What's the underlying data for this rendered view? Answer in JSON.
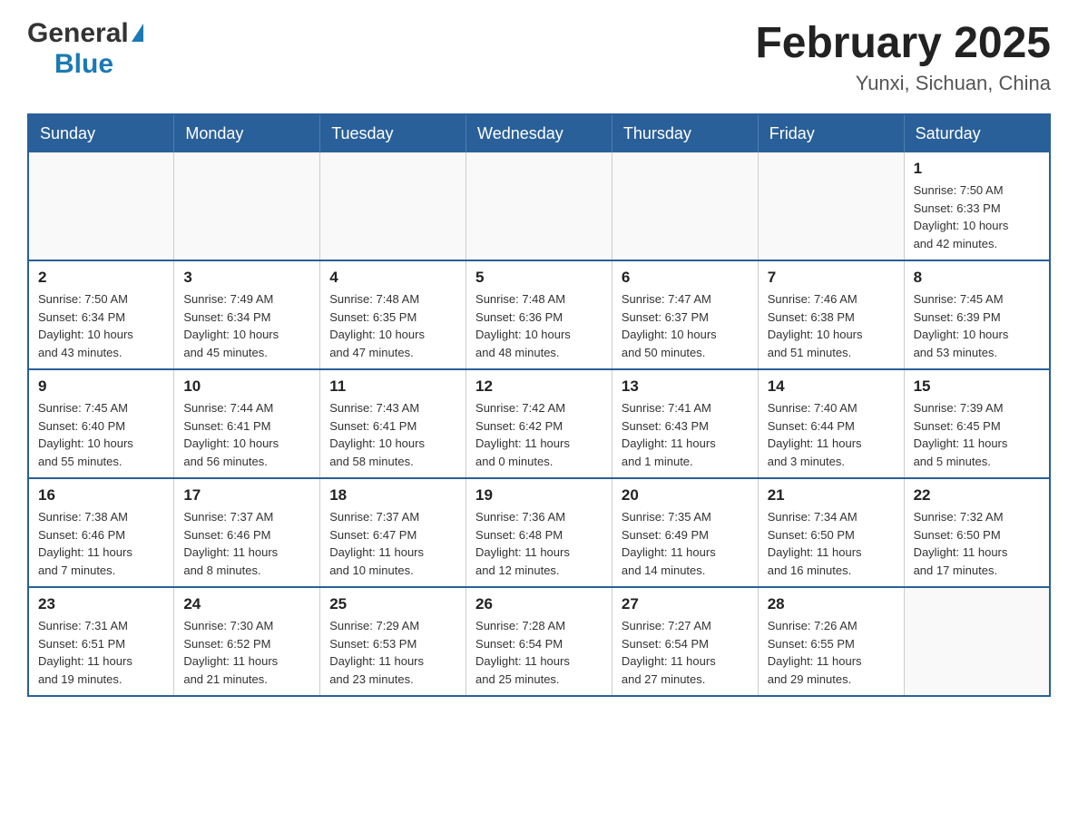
{
  "header": {
    "title": "February 2025",
    "location": "Yunxi, Sichuan, China",
    "logo_general": "General",
    "logo_blue": "Blue"
  },
  "calendar": {
    "days_of_week": [
      "Sunday",
      "Monday",
      "Tuesday",
      "Wednesday",
      "Thursday",
      "Friday",
      "Saturday"
    ],
    "weeks": [
      [
        {
          "day": "",
          "info": ""
        },
        {
          "day": "",
          "info": ""
        },
        {
          "day": "",
          "info": ""
        },
        {
          "day": "",
          "info": ""
        },
        {
          "day": "",
          "info": ""
        },
        {
          "day": "",
          "info": ""
        },
        {
          "day": "1",
          "info": "Sunrise: 7:50 AM\nSunset: 6:33 PM\nDaylight: 10 hours\nand 42 minutes."
        }
      ],
      [
        {
          "day": "2",
          "info": "Sunrise: 7:50 AM\nSunset: 6:34 PM\nDaylight: 10 hours\nand 43 minutes."
        },
        {
          "day": "3",
          "info": "Sunrise: 7:49 AM\nSunset: 6:34 PM\nDaylight: 10 hours\nand 45 minutes."
        },
        {
          "day": "4",
          "info": "Sunrise: 7:48 AM\nSunset: 6:35 PM\nDaylight: 10 hours\nand 47 minutes."
        },
        {
          "day": "5",
          "info": "Sunrise: 7:48 AM\nSunset: 6:36 PM\nDaylight: 10 hours\nand 48 minutes."
        },
        {
          "day": "6",
          "info": "Sunrise: 7:47 AM\nSunset: 6:37 PM\nDaylight: 10 hours\nand 50 minutes."
        },
        {
          "day": "7",
          "info": "Sunrise: 7:46 AM\nSunset: 6:38 PM\nDaylight: 10 hours\nand 51 minutes."
        },
        {
          "day": "8",
          "info": "Sunrise: 7:45 AM\nSunset: 6:39 PM\nDaylight: 10 hours\nand 53 minutes."
        }
      ],
      [
        {
          "day": "9",
          "info": "Sunrise: 7:45 AM\nSunset: 6:40 PM\nDaylight: 10 hours\nand 55 minutes."
        },
        {
          "day": "10",
          "info": "Sunrise: 7:44 AM\nSunset: 6:41 PM\nDaylight: 10 hours\nand 56 minutes."
        },
        {
          "day": "11",
          "info": "Sunrise: 7:43 AM\nSunset: 6:41 PM\nDaylight: 10 hours\nand 58 minutes."
        },
        {
          "day": "12",
          "info": "Sunrise: 7:42 AM\nSunset: 6:42 PM\nDaylight: 11 hours\nand 0 minutes."
        },
        {
          "day": "13",
          "info": "Sunrise: 7:41 AM\nSunset: 6:43 PM\nDaylight: 11 hours\nand 1 minute."
        },
        {
          "day": "14",
          "info": "Sunrise: 7:40 AM\nSunset: 6:44 PM\nDaylight: 11 hours\nand 3 minutes."
        },
        {
          "day": "15",
          "info": "Sunrise: 7:39 AM\nSunset: 6:45 PM\nDaylight: 11 hours\nand 5 minutes."
        }
      ],
      [
        {
          "day": "16",
          "info": "Sunrise: 7:38 AM\nSunset: 6:46 PM\nDaylight: 11 hours\nand 7 minutes."
        },
        {
          "day": "17",
          "info": "Sunrise: 7:37 AM\nSunset: 6:46 PM\nDaylight: 11 hours\nand 8 minutes."
        },
        {
          "day": "18",
          "info": "Sunrise: 7:37 AM\nSunset: 6:47 PM\nDaylight: 11 hours\nand 10 minutes."
        },
        {
          "day": "19",
          "info": "Sunrise: 7:36 AM\nSunset: 6:48 PM\nDaylight: 11 hours\nand 12 minutes."
        },
        {
          "day": "20",
          "info": "Sunrise: 7:35 AM\nSunset: 6:49 PM\nDaylight: 11 hours\nand 14 minutes."
        },
        {
          "day": "21",
          "info": "Sunrise: 7:34 AM\nSunset: 6:50 PM\nDaylight: 11 hours\nand 16 minutes."
        },
        {
          "day": "22",
          "info": "Sunrise: 7:32 AM\nSunset: 6:50 PM\nDaylight: 11 hours\nand 17 minutes."
        }
      ],
      [
        {
          "day": "23",
          "info": "Sunrise: 7:31 AM\nSunset: 6:51 PM\nDaylight: 11 hours\nand 19 minutes."
        },
        {
          "day": "24",
          "info": "Sunrise: 7:30 AM\nSunset: 6:52 PM\nDaylight: 11 hours\nand 21 minutes."
        },
        {
          "day": "25",
          "info": "Sunrise: 7:29 AM\nSunset: 6:53 PM\nDaylight: 11 hours\nand 23 minutes."
        },
        {
          "day": "26",
          "info": "Sunrise: 7:28 AM\nSunset: 6:54 PM\nDaylight: 11 hours\nand 25 minutes."
        },
        {
          "day": "27",
          "info": "Sunrise: 7:27 AM\nSunset: 6:54 PM\nDaylight: 11 hours\nand 27 minutes."
        },
        {
          "day": "28",
          "info": "Sunrise: 7:26 AM\nSunset: 6:55 PM\nDaylight: 11 hours\nand 29 minutes."
        },
        {
          "day": "",
          "info": ""
        }
      ]
    ]
  }
}
